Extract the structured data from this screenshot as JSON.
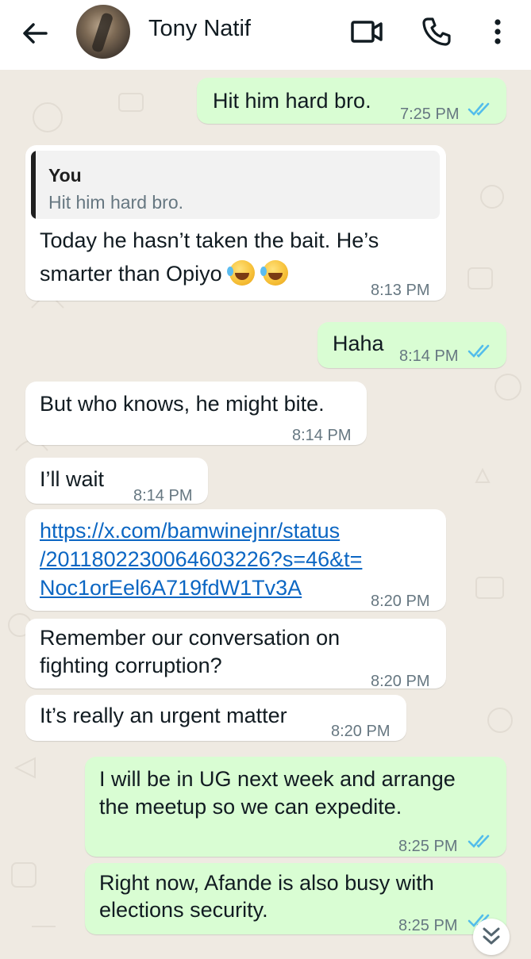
{
  "header": {
    "contact_name": "Tony Natif",
    "back_icon": "arrow-left-icon",
    "video_icon": "video-camera-icon",
    "call_icon": "phone-icon",
    "more_icon": "more-vertical-icon"
  },
  "colors": {
    "incoming_bubble": "#ffffff",
    "outgoing_bubble": "#d9fdd3",
    "read_ticks": "#53bdeb",
    "link": "#0b66c3",
    "chat_background": "#efeae2"
  },
  "messages": [
    {
      "direction": "outgoing",
      "text": "Hit him hard bro.",
      "time": "7:25 PM",
      "status": "read"
    },
    {
      "direction": "incoming",
      "quote": {
        "author": "You",
        "text": "Hit him hard bro."
      },
      "lines": [
        "Today he hasn’t taken the bait. He’s",
        "smarter than Opiyo"
      ],
      "emojis": [
        "rolling-on-floor-laughing",
        "rolling-on-floor-laughing"
      ],
      "time": "8:13 PM"
    },
    {
      "direction": "outgoing",
      "text": "Haha",
      "time": "8:14 PM",
      "status": "read"
    },
    {
      "direction": "incoming",
      "text": "But who knows, he might bite.",
      "time": "8:14 PM"
    },
    {
      "direction": "incoming",
      "text": "I’ll wait",
      "time": "8:14 PM"
    },
    {
      "direction": "incoming",
      "link_lines": [
        "https://x.com/bamwinejnr/status",
        "/2011802230064603226?s=46&t=",
        "Noc1orEel6A719fdW1Tv3A"
      ],
      "time": "8:20 PM"
    },
    {
      "direction": "incoming",
      "lines": [
        "Remember our conversation on",
        "fighting corruption?"
      ],
      "time": "8:20 PM"
    },
    {
      "direction": "incoming",
      "text": "It’s really an urgent matter",
      "time": "8:20 PM"
    },
    {
      "direction": "outgoing",
      "lines": [
        "I will be in UG next week and arrange",
        "the meetup so we can expedite."
      ],
      "time": "8:25 PM",
      "status": "read"
    },
    {
      "direction": "outgoing",
      "lines": [
        "Right now, Afande is also busy with",
        "elections security."
      ],
      "time": "8:25 PM",
      "status": "read"
    }
  ],
  "scroll_button_icon": "double-chevron-down-icon"
}
